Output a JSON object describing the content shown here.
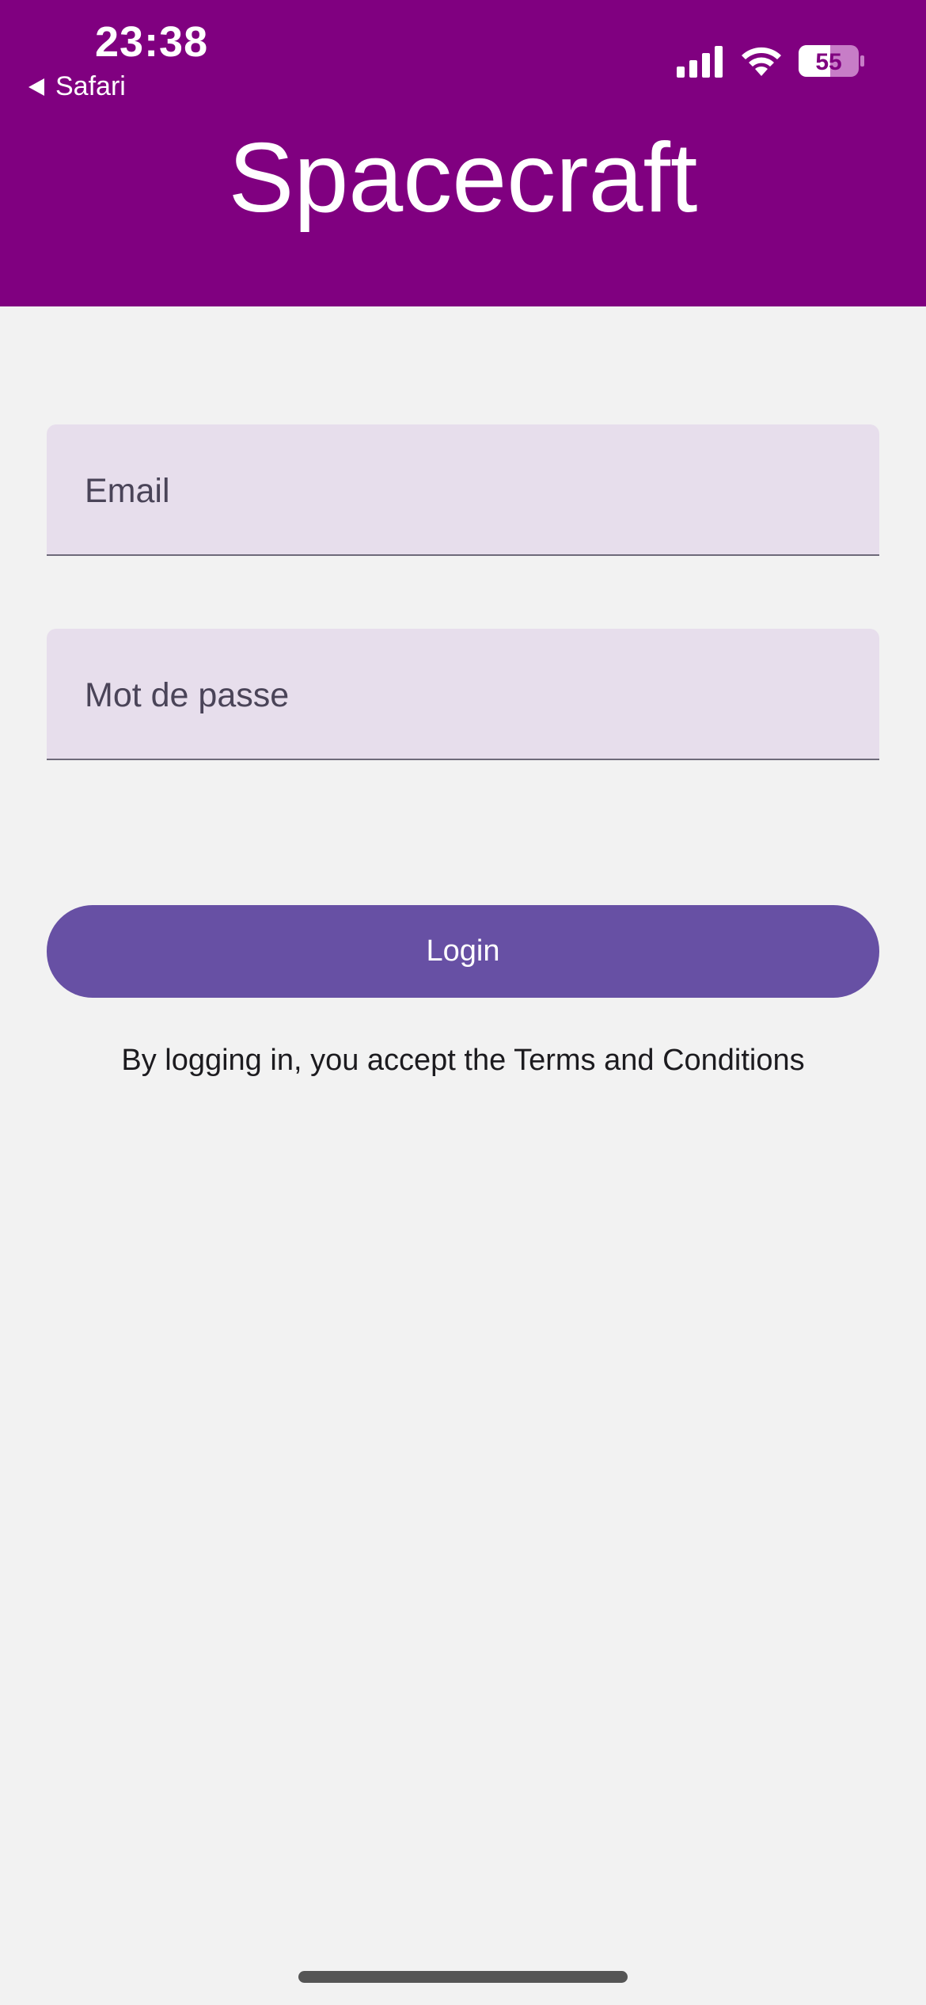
{
  "status_bar": {
    "time": "23:38",
    "back_label": "Safari",
    "battery_level": "55"
  },
  "header": {
    "title": "Spacecraft"
  },
  "form": {
    "email_placeholder": "Email",
    "password_placeholder": "Mot de passe",
    "login_label": "Login",
    "terms_text": "By logging in, you accept the Terms and Conditions"
  },
  "colors": {
    "header_bg": "#800080",
    "field_bg": "#e7deec",
    "button_bg": "#6750a4",
    "page_bg": "#f2f2f2"
  },
  "icons": {
    "signal": "cellular-signal-icon",
    "wifi": "wifi-icon",
    "battery": "battery-icon",
    "back": "back-triangle-icon"
  }
}
